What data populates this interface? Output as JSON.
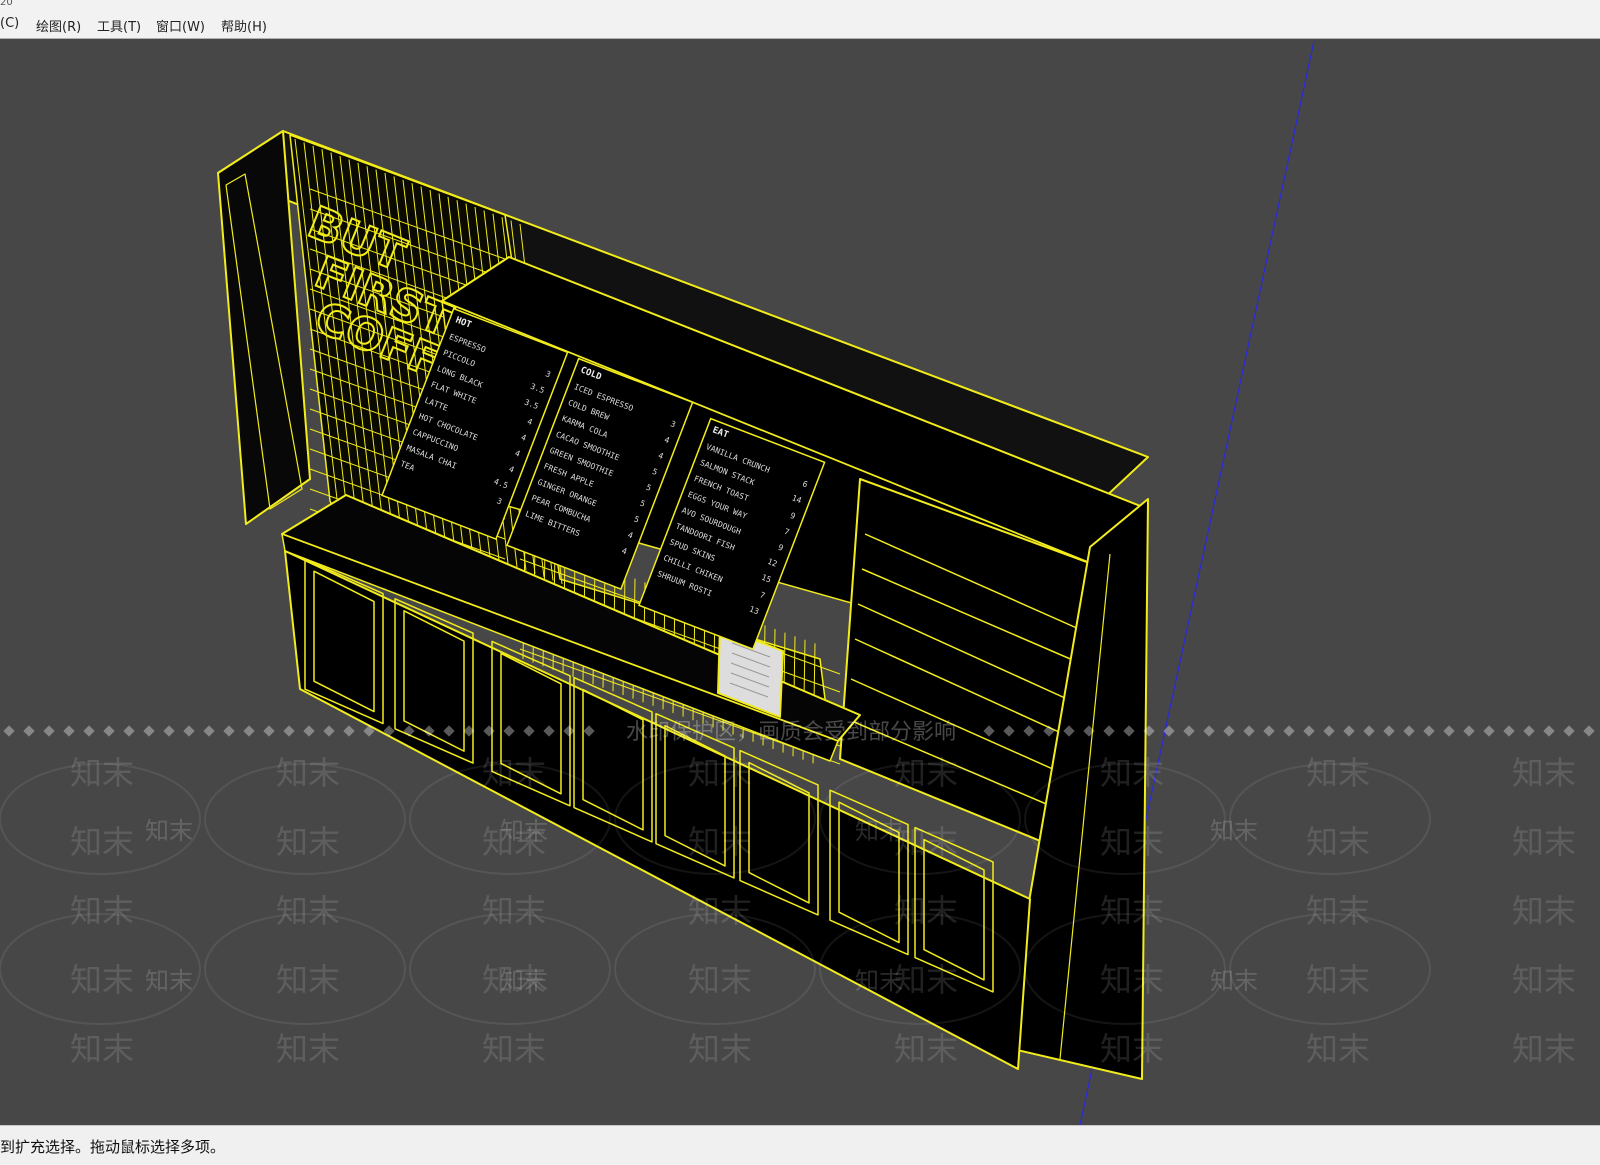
{
  "app": {
    "title_fragment": "20"
  },
  "menu": [
    {
      "label": "(C)"
    },
    {
      "label": "绘图(R)"
    },
    {
      "label": "工具(T)"
    },
    {
      "label": "窗口(W)"
    },
    {
      "label": "帮助(H)"
    }
  ],
  "watermark": {
    "brand": "知末",
    "notice": "水印保护区，画质会受到部分影响"
  },
  "model": {
    "sign_text": [
      "BUT",
      "FIRST",
      "COFFEE"
    ],
    "menu_boards": [
      {
        "heading": "HOT",
        "items": [
          "ESPRESSO",
          "PICCOLO",
          "LONG BLACK",
          "FLAT WHITE",
          "LATTE",
          "HOT CHOCOLATE",
          "CAPPUCCINO",
          "MASALA CHAI",
          "TEA"
        ],
        "prices": [
          "3",
          "3.5",
          "3.5",
          "4",
          "4",
          "4",
          "4",
          "4.5",
          "3"
        ]
      },
      {
        "heading": "COLD",
        "items": [
          "ICED ESPRESSO",
          "COLD BREW",
          "KARMA COLA",
          "CACAO SMOOTHIE",
          "GREEN SMOOTHIE",
          "FRESH APPLE",
          "GINGER ORANGE",
          "PEAR COMBUCHA",
          "LIME BITTERS"
        ],
        "prices": [
          "3",
          "4",
          "4",
          "5",
          "5",
          "5",
          "5",
          "4",
          "4"
        ]
      },
      {
        "heading": "EAT",
        "items": [
          "VANILLA CRUNCH",
          "SALMON STACK",
          "FRENCH TOAST",
          "EGGS YOUR WAY",
          "AVO SOURDOUGH",
          "TANDOORI FISH",
          "SPUD SKINS",
          "CHILLI CHIKEN",
          "SHRUUM ROSTI"
        ],
        "prices": [
          "6",
          "14",
          "9",
          "7",
          "9",
          "12",
          "15",
          "7",
          "13"
        ]
      }
    ]
  },
  "status": {
    "text": "到扩充选择。拖动鼠标选择多项。"
  },
  "colors": {
    "wireframe": "#f2ec1c",
    "background": "#474747",
    "axis_blue": "#2a2ae0",
    "model_fill": "#000000"
  }
}
